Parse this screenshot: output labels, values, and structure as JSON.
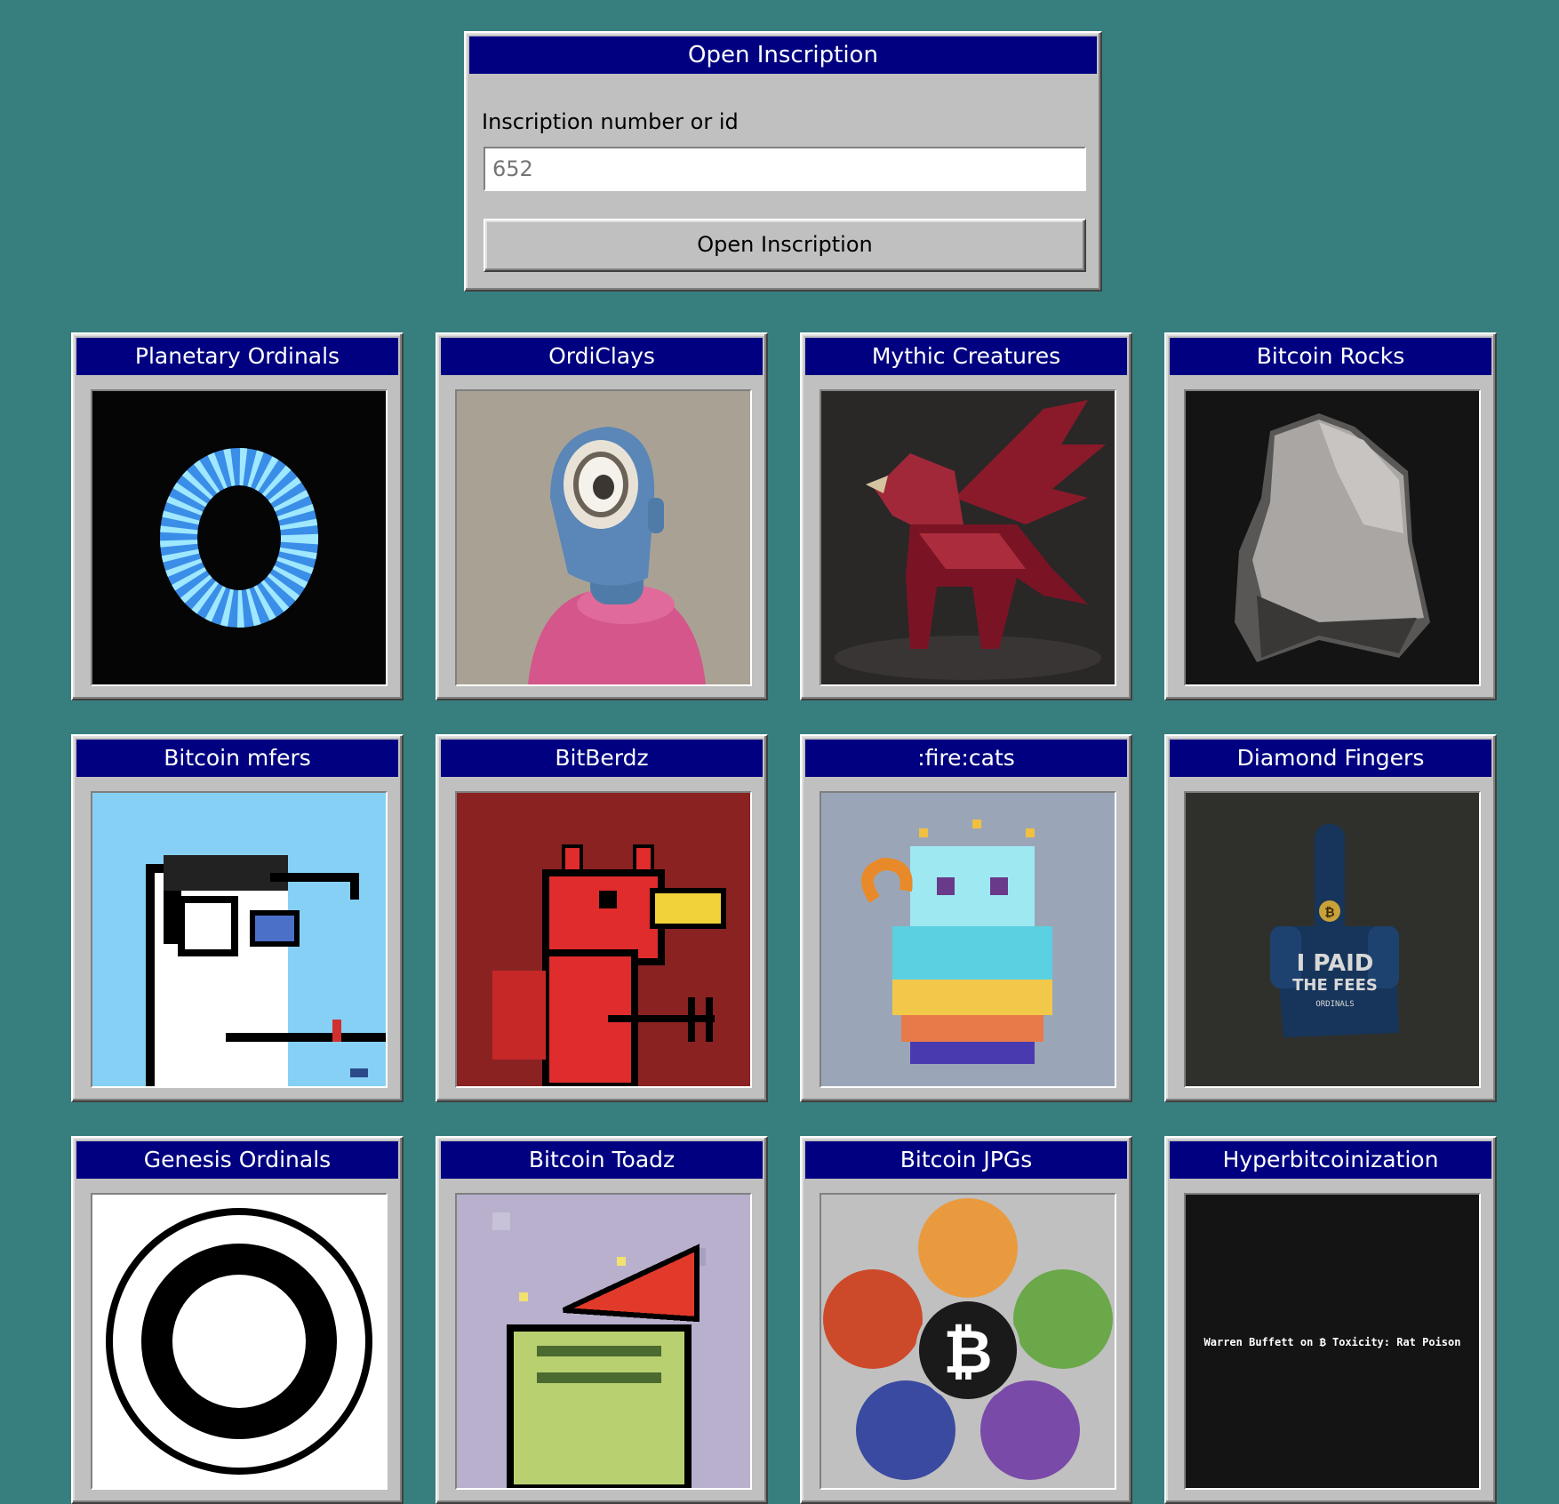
{
  "dialog": {
    "title": "Open Inscription",
    "field_label": "Inscription number or id",
    "input_placeholder": "652",
    "button_label": "Open Inscription"
  },
  "collections": [
    {
      "title": "Planetary Ordinals",
      "image": "blue-torus-on-black"
    },
    {
      "title": "OrdiClays",
      "image": "clay-figure-pink-sweater"
    },
    {
      "title": "Mythic Creatures",
      "image": "red-crystal-griffin"
    },
    {
      "title": "Bitcoin Rocks",
      "image": "grey-rock-on-black"
    },
    {
      "title": "Bitcoin mfers",
      "image": "pixel-mfer-headphones"
    },
    {
      "title": "BitBerdz",
      "image": "pixel-red-devil-bird"
    },
    {
      "title": ":fire:cats",
      "image": "rainbow-pixel-cat"
    },
    {
      "title": "Diamond Fingers",
      "image": "middle-finger-i-paid-the-fees"
    },
    {
      "title": "Genesis Ordinals",
      "image": "black-white-ring"
    },
    {
      "title": "Bitcoin Toadz",
      "image": "pixel-toad-red-hat"
    },
    {
      "title": "Bitcoin JPGs",
      "image": "bitcoin-colored-circles"
    },
    {
      "title": "Hyperbitcoinization",
      "image": "black-text-card",
      "caption": "Warren Buffett on ₿ Toxicity: Rat Poison"
    }
  ],
  "card_image_texts": {
    "diamond_fingers": [
      "I PAID",
      "THE FEES",
      "ORDINALS"
    ],
    "bitcoin_symbol": "₿"
  }
}
